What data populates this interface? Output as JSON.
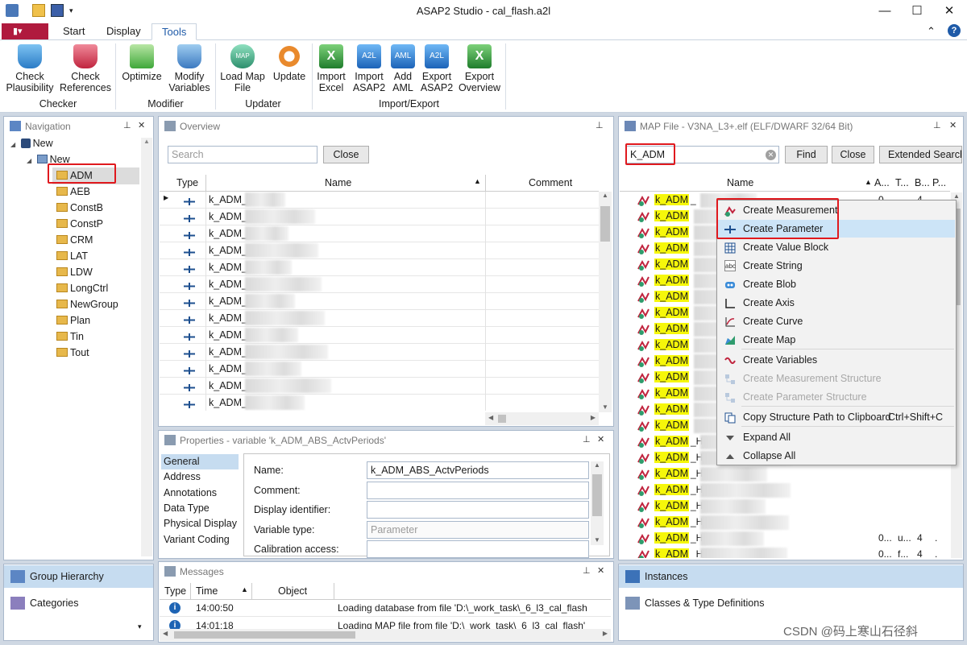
{
  "window": {
    "title": "ASAP2 Studio - cal_flash.a2l",
    "min": "—",
    "max": "☐",
    "close": "✕"
  },
  "tabs": {
    "file": "▮▾",
    "start": "Start",
    "display": "Display",
    "tools": "Tools",
    "help": "?",
    "collapse": "⌃"
  },
  "ribbon": {
    "check_plausibility": [
      "Check",
      "Plausibility"
    ],
    "check_references": [
      "Check",
      "References"
    ],
    "optimize": "Optimize",
    "modify_variables": [
      "Modify",
      "Variables"
    ],
    "load_map": [
      "Load Map",
      "File"
    ],
    "update": "Update",
    "import_excel": [
      "Import",
      "Excel"
    ],
    "import_asap2": [
      "Import",
      "ASAP2"
    ],
    "add_aml": [
      "Add",
      "AML"
    ],
    "export_asap2": [
      "Export",
      "ASAP2"
    ],
    "export_overview": [
      "Export",
      "Overview"
    ],
    "groups": {
      "checker": "Checker",
      "modifier": "Modifier",
      "updater": "Updater",
      "importexport": "Import/Export"
    },
    "icon_labels": {
      "map": "MAP",
      "a2l": "A2L",
      "aml": "AML"
    }
  },
  "navigation": {
    "title": "Navigation",
    "root": "New",
    "child": "New",
    "folders": [
      "ADM",
      "AEB",
      "ConstB",
      "ConstP",
      "CRM",
      "LAT",
      "LDW",
      "LongCtrl",
      "NewGroup",
      "Plan",
      "Tin",
      "Tout"
    ],
    "bottom_tabs": [
      "Group Hierarchy",
      "Categories"
    ]
  },
  "overview": {
    "title": "Overview",
    "search_placeholder": "Search",
    "close": "Close",
    "columns": [
      "Type",
      "Name",
      "Comment"
    ],
    "rows": [
      "k_ADM_",
      "k_ADM_",
      "k_ADM_",
      "k_ADM_",
      "k_ADM_",
      "k_ADM_",
      "k_ADM_",
      "k_ADM_",
      "k_ADM_",
      "k_ADM_",
      "k_ADM_",
      "k_ADM_",
      "k_ADM_"
    ]
  },
  "properties": {
    "title": "Properties - variable 'k_ADM_ABS_ActvPeriods'",
    "categories": [
      "General",
      "Address",
      "Annotations",
      "Data Type",
      "Physical Display",
      "Variant Coding"
    ],
    "fields": [
      {
        "label": "Name:",
        "value": "k_ADM_ABS_ActvPeriods"
      },
      {
        "label": "Comment:",
        "value": ""
      },
      {
        "label": "Display identifier:",
        "value": ""
      },
      {
        "label": "Variable type:",
        "value": "Parameter"
      },
      {
        "label": "Calibration access:",
        "value": ""
      }
    ]
  },
  "messages": {
    "title": "Messages",
    "columns": [
      "Type",
      "Time",
      "Object",
      ""
    ],
    "rows": [
      {
        "time": "14:00:50",
        "text": "Loading database from file 'D:\\_work_task\\_6_l3_cal_flash"
      },
      {
        "time": "14:01:18",
        "text": "Loading MAP file from file 'D:\\_work_task\\_6_l3_cal_flash'"
      }
    ]
  },
  "mapfile": {
    "title": "MAP File - V3NA_L3+.elf (ELF/DWARF 32/64 Bit)",
    "search_value": "K_ADM",
    "find": "Find",
    "close": "Close",
    "extended": "Extended Search",
    "columns": [
      "Name",
      "A...",
      "T...",
      "B...",
      "P..."
    ],
    "highlight": "k_ADM",
    "rows": [
      {
        "mid": "_",
        "c1": "0..",
        "c2": "",
        "c3": "4",
        "c4": "."
      },
      {
        "mid": "",
        "c1": "",
        "c2": "",
        "c3": "",
        "c4": ""
      },
      {
        "mid": "",
        "c1": "",
        "c2": "",
        "c3": "",
        "c4": ""
      },
      {
        "mid": "",
        "c1": "",
        "c2": "",
        "c3": "",
        "c4": ""
      },
      {
        "mid": "",
        "c1": "",
        "c2": "",
        "c3": "",
        "c4": ""
      },
      {
        "mid": "",
        "c1": "",
        "c2": "",
        "c3": "",
        "c4": ""
      },
      {
        "mid": "",
        "c1": "",
        "c2": "",
        "c3": "",
        "c4": ""
      },
      {
        "mid": "",
        "c1": "",
        "c2": "",
        "c3": "",
        "c4": ""
      },
      {
        "mid": "",
        "c1": "",
        "c2": "",
        "c3": "",
        "c4": ""
      },
      {
        "mid": "",
        "c1": "",
        "c2": "",
        "c3": "",
        "c4": ""
      },
      {
        "mid": "",
        "c1": "",
        "c2": "",
        "c3": "",
        "c4": ""
      },
      {
        "mid": "",
        "c1": "",
        "c2": "",
        "c3": "",
        "c4": ""
      },
      {
        "mid": "",
        "c1": "",
        "c2": "",
        "c3": "",
        "c4": ""
      },
      {
        "mid": "",
        "c1": "",
        "c2": "",
        "c3": "",
        "c4": ""
      },
      {
        "mid": "",
        "c1": "",
        "c2": "",
        "c3": "",
        "c4": ""
      },
      {
        "mid": "_H",
        "c1": "",
        "c2": "",
        "c3": "",
        "c4": ""
      },
      {
        "mid": "_H",
        "c1": "",
        "c2": "",
        "c3": "",
        "c4": ""
      },
      {
        "mid": "_H",
        "c1": "",
        "c2": "",
        "c3": "",
        "c4": ""
      },
      {
        "mid": "_H",
        "c1": "",
        "c2": "",
        "c3": "",
        "c4": ""
      },
      {
        "mid": "_H",
        "c1": "",
        "c2": "",
        "c3": "",
        "c4": ""
      },
      {
        "mid": "_H",
        "c1": "",
        "c2": "",
        "c3": "",
        "c4": ""
      },
      {
        "mid": "_H",
        "c1": "0...",
        "c2": "u...",
        "c3": "4",
        "c4": "."
      },
      {
        "mid": "_H",
        "c1": "0...",
        "c2": "f...",
        "c3": "4",
        "c4": "."
      },
      {
        "mid": "_H",
        "c1": "0...",
        "c2": "f...",
        "c3": "4",
        "c4": "."
      },
      {
        "mid": "_H",
        "c1": "0...",
        "c2": "f...",
        "c3": "4",
        "c4": "."
      },
      {
        "mid": "",
        "c1": "0...",
        "c2": "f...",
        "c3": "4",
        "c4": "."
      },
      {
        "mid": "_M",
        "c1": "0...",
        "c2": "u...",
        "c3": "4",
        "c4": "."
      }
    ],
    "bottom_tabs": [
      "Instances",
      "Classes & Type Definitions"
    ]
  },
  "context_menu": [
    {
      "label": "Create Measurement",
      "icon": "measurement-icon",
      "enabled": true
    },
    {
      "label": "Create Parameter",
      "icon": "parameter-icon",
      "enabled": true
    },
    {
      "label": "Create Value Block",
      "icon": "value-block-icon",
      "enabled": true
    },
    {
      "label": "Create String",
      "icon": "string-icon",
      "enabled": true
    },
    {
      "label": "Create Blob",
      "icon": "blob-icon",
      "enabled": true
    },
    {
      "label": "Create Axis",
      "icon": "axis-icon",
      "enabled": true
    },
    {
      "label": "Create Curve",
      "icon": "curve-icon",
      "enabled": true
    },
    {
      "label": "Create Map",
      "icon": "map-icon",
      "enabled": true
    },
    {
      "label": "Create Variables",
      "icon": "variables-icon",
      "enabled": true
    },
    {
      "label": "Create Measurement Structure",
      "icon": "structure-icon",
      "enabled": false
    },
    {
      "label": "Create Parameter Structure",
      "icon": "structure-icon",
      "enabled": false
    },
    {
      "label": "Copy Structure Path to Clipboard",
      "shortcut": "Ctrl+Shift+C",
      "icon": "copy-icon",
      "enabled": true
    },
    {
      "label": "Expand All",
      "icon": "expand-icon",
      "enabled": true
    },
    {
      "label": "Collapse All",
      "icon": "collapse-icon",
      "enabled": true
    }
  ],
  "icon_text": {
    "abc": "abc",
    "nav": "▦",
    "pin": "📌",
    "close": "✕",
    "sortup": "▲",
    "cols": "⋯"
  },
  "watermark": "CSDN @码上寒山石径斜",
  "colors": {
    "accent": "#1e5aa8",
    "file_tab": "#b01a3e",
    "highlight": "#f6f70a",
    "annotation": "#e0191e"
  }
}
